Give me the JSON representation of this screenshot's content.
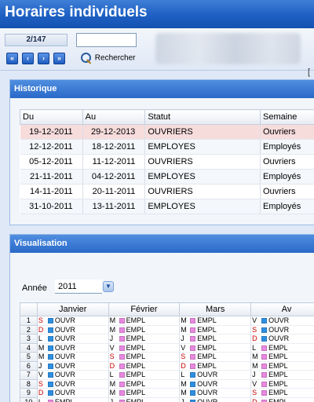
{
  "window": {
    "title": "Horaires individuels"
  },
  "toolbar": {
    "counter": "2/147",
    "nav": [
      "«",
      "‹",
      "›",
      "»"
    ],
    "search_value": "",
    "search_label": "Rechercher",
    "bracket": "["
  },
  "historique": {
    "title": "Historique",
    "columns": [
      "Du",
      "Au",
      "Statut",
      "Semaine"
    ],
    "rows": [
      [
        "19-12-2011",
        "29-12-2013",
        "OUVRIERS",
        "Ouvriers"
      ],
      [
        "12-12-2011",
        "18-12-2011",
        "EMPLOYES",
        "Employés"
      ],
      [
        "05-12-2011",
        "11-12-2011",
        "OUVRIERS",
        "Ouvriers"
      ],
      [
        "21-11-2011",
        "04-12-2011",
        "EMPLOYES",
        "Employés"
      ],
      [
        "14-11-2011",
        "20-11-2011",
        "OUVRIERS",
        "Ouvriers"
      ],
      [
        "31-10-2011",
        "13-11-2011",
        "EMPLOYES",
        "Employés"
      ]
    ]
  },
  "visualisation": {
    "title": "Visualisation",
    "year_label": "Année",
    "year_value": "2011",
    "months": [
      "Janvier",
      "Février",
      "Mars",
      "Av"
    ],
    "colors": {
      "OUVR": "#2f8fe0",
      "EMPL": "#e889e0"
    },
    "rows": [
      [
        "1",
        [
          "S",
          "OUVR"
        ],
        [
          "M",
          "EMPL"
        ],
        [
          "M",
          "EMPL"
        ],
        [
          "V",
          "OUVR"
        ]
      ],
      [
        "2",
        [
          "D",
          "OUVR"
        ],
        [
          "M",
          "EMPL"
        ],
        [
          "M",
          "EMPL"
        ],
        [
          "S",
          "OUVR"
        ]
      ],
      [
        "3",
        [
          "L",
          "OUVR"
        ],
        [
          "J",
          "EMPL"
        ],
        [
          "J",
          "EMPL"
        ],
        [
          "D",
          "OUVR"
        ]
      ],
      [
        "4",
        [
          "M",
          "OUVR"
        ],
        [
          "V",
          "EMPL"
        ],
        [
          "V",
          "EMPL"
        ],
        [
          "L",
          "EMPL"
        ]
      ],
      [
        "5",
        [
          "M",
          "OUVR"
        ],
        [
          "S",
          "EMPL"
        ],
        [
          "S",
          "EMPL"
        ],
        [
          "M",
          "EMPL"
        ]
      ],
      [
        "6",
        [
          "J",
          "OUVR"
        ],
        [
          "D",
          "EMPL"
        ],
        [
          "D",
          "EMPL"
        ],
        [
          "M",
          "EMPL"
        ]
      ],
      [
        "7",
        [
          "V",
          "OUVR"
        ],
        [
          "L",
          "EMPL"
        ],
        [
          "L",
          "OUVR"
        ],
        [
          "J",
          "EMPL"
        ]
      ],
      [
        "8",
        [
          "S",
          "OUVR"
        ],
        [
          "M",
          "EMPL"
        ],
        [
          "M",
          "OUVR"
        ],
        [
          "V",
          "EMPL"
        ]
      ],
      [
        "9",
        [
          "D",
          "OUVR"
        ],
        [
          "M",
          "EMPL"
        ],
        [
          "M",
          "OUVR"
        ],
        [
          "S",
          "EMPL"
        ]
      ],
      [
        "10",
        [
          "L",
          "EMPL"
        ],
        [
          "J",
          "EMPL"
        ],
        [
          "J",
          "OUVR"
        ],
        [
          "D",
          "EMPL"
        ]
      ]
    ]
  }
}
